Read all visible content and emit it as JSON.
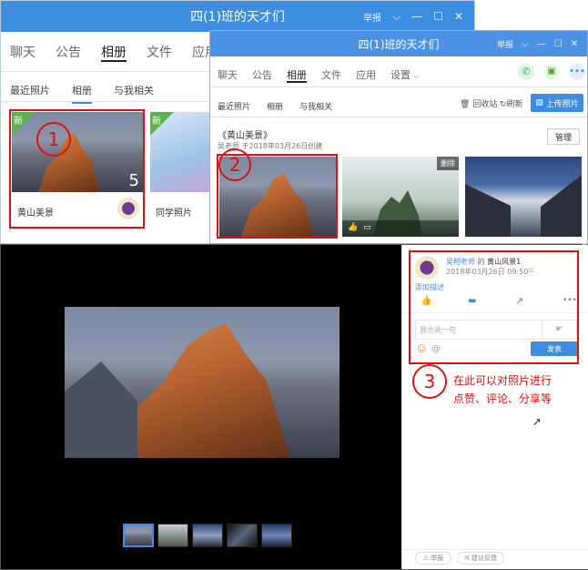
{
  "back_window": {
    "title": "四(1)班的天才们",
    "report": "举报",
    "tabs": [
      "聊天",
      "公告",
      "相册",
      "文件",
      "应用"
    ],
    "active_tab": 2,
    "subtabs": [
      "最近照片",
      "相册",
      "与我相关"
    ],
    "active_sub": 1,
    "albums": [
      {
        "name": "黄山美景",
        "count": "5",
        "badge": "新"
      },
      {
        "name": "同学照片",
        "badge": "新"
      }
    ]
  },
  "front_window": {
    "title": "四(1)班的天才们",
    "report": "举报",
    "tabs": [
      "聊天",
      "公告",
      "相册",
      "文件",
      "应用",
      "设置"
    ],
    "active_tab": 2,
    "subtabs": [
      "最近照片",
      "相册",
      "与我相关"
    ],
    "active_sub": 1,
    "recycle": "回收站",
    "refresh": "刷新",
    "upload": "上传照片",
    "album_title": "《黄山美景》",
    "album_meta": "吴老师 于2018年03月26日创建",
    "manage": "管理",
    "delete": "删除"
  },
  "viewer": {
    "user": "吴相老师",
    "of": "的",
    "album": "黄山风景1",
    "time": "2018年03月26日 09:50",
    "add_desc": "添加描述",
    "comment_placeholder": "我也说一句",
    "send": "发表",
    "footer_report": "举报",
    "footer_feedback": "建议反馈"
  },
  "annotations": {
    "n1": "1",
    "n2": "2",
    "n3": "3",
    "note_line1": "在此可以对照片进行",
    "note_line2": "点赞、评论、分享等"
  },
  "colors": {
    "accent": "#3d8ee0",
    "annotation": "#e01010"
  }
}
